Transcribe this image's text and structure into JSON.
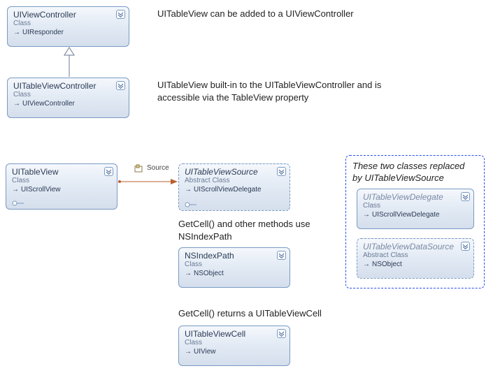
{
  "classes": {
    "uiviewcontroller": {
      "name": "UIViewController",
      "kind": "Class",
      "parent": "UIResponder"
    },
    "uitableviewcontroller": {
      "name": "UITableViewController",
      "kind": "Class",
      "parent": "UIViewController"
    },
    "uitableview": {
      "name": "UITableView",
      "kind": "Class",
      "parent": "UIScrollView"
    },
    "uitableviewsource": {
      "name": "UITableViewSource",
      "kind": "Abstract Class",
      "parent": "UIScrollViewDelegate"
    },
    "nsindexpath": {
      "name": "NSIndexPath",
      "kind": "Class",
      "parent": "NSObject"
    },
    "uitableviewcell": {
      "name": "UITableViewCell",
      "kind": "Class",
      "parent": "UIView"
    },
    "uitableviewdelegate": {
      "name": "UITableViewDelegate",
      "kind": "Class",
      "parent": "UIScrollViewDelegate"
    },
    "uitableviewdatasource": {
      "name": "UITableViewDataSource",
      "kind": "Abstract Class",
      "parent": "NSObject"
    }
  },
  "annotations": {
    "a1": "UITableView can be added to a  UIViewController",
    "a2": "UITableView built-in to the UITableViewController and is accessible via the TableView property",
    "a3": "GetCell() and other methods use NSIndexPath",
    "a4": "GetCell() returns a UITableViewCell",
    "a5a": "These two classes replaced",
    "a5b": "by UITableViewSource"
  },
  "labels": {
    "source": "Source"
  },
  "arrow_glyph": "→"
}
